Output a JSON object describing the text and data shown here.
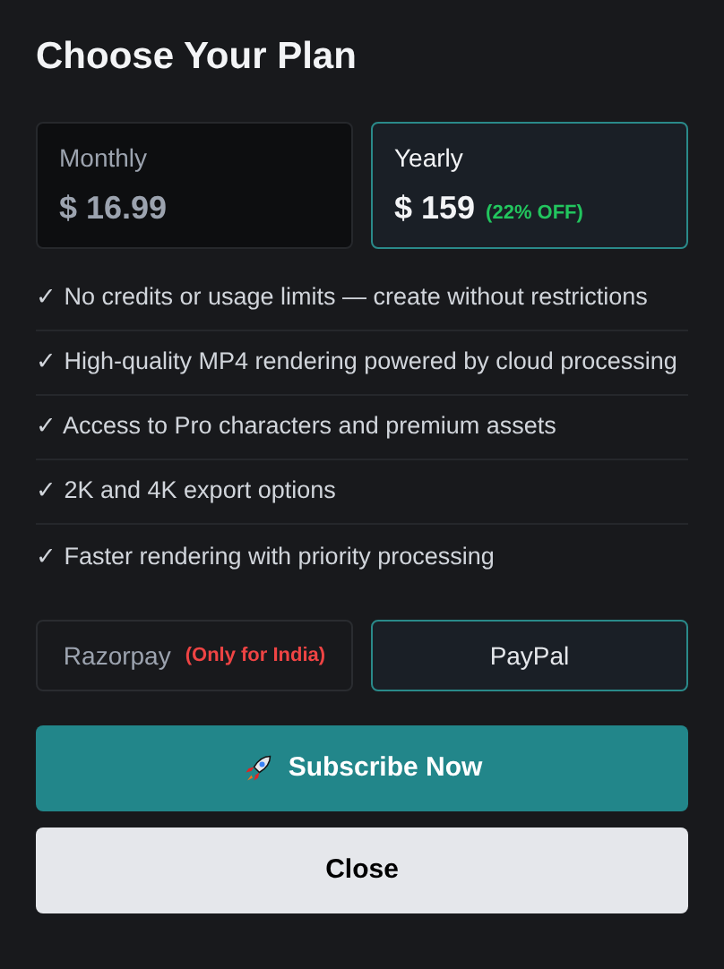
{
  "title": "Choose Your Plan",
  "plans": [
    {
      "name": "Monthly",
      "price": "$ 16.99",
      "selected": false
    },
    {
      "name": "Yearly",
      "price": "$ 159",
      "discount": "(22% OFF)",
      "selected": true
    }
  ],
  "features": [
    "✓ No credits or usage limits — create without restrictions",
    "✓ High-quality MP4 rendering powered by cloud processing",
    "✓ Access to Pro characters and premium assets",
    "✓ 2K and 4K export options",
    "✓ Faster rendering with priority processing"
  ],
  "payment_methods": [
    {
      "name": "Razorpay",
      "note": "(Only for India)",
      "selected": false
    },
    {
      "name": "PayPal",
      "selected": true
    }
  ],
  "buttons": [
    {
      "kind": "primary",
      "label": "Subscribe Now"
    },
    {
      "kind": "secondary",
      "label": "Close"
    }
  ]
}
